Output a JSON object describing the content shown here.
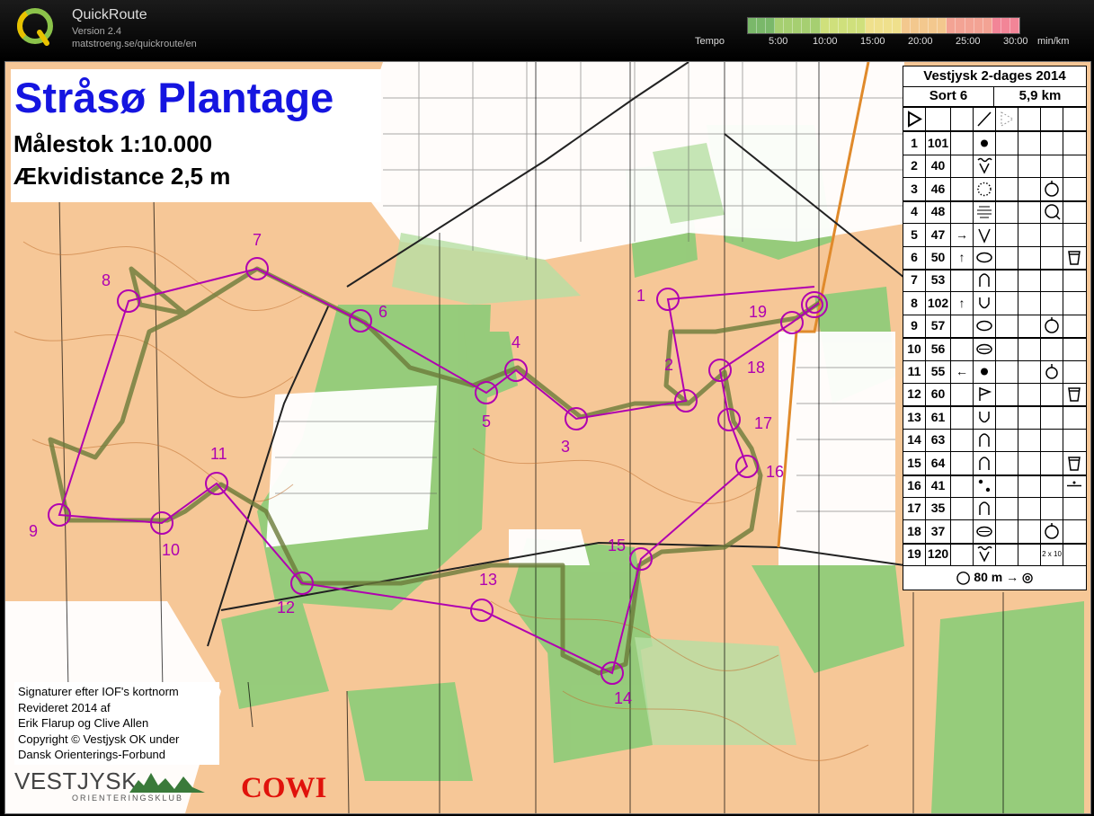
{
  "app": {
    "name": "QuickRoute",
    "version": "Version 2.4",
    "url": "matstroeng.se/quickroute/en",
    "logo_letter": "Q"
  },
  "tempo": {
    "label": "Tempo",
    "ticks": [
      "5:00",
      "10:00",
      "15:00",
      "20:00",
      "25:00",
      "30:00"
    ],
    "unit": "min/km",
    "colors": [
      "#7ab86a",
      "#a6cf71",
      "#cfe07c",
      "#efe08c",
      "#f3c88e",
      "#f3a394",
      "#f28597"
    ]
  },
  "map": {
    "title": "Stråsø Plantage",
    "scale": "Målestok 1:10.000",
    "contour": "Ækvidistance 2,5 m",
    "credits": [
      "Signaturer efter IOF's kortnorm",
      "Revideret 2014 af",
      "Erik Flarup og Clive Allen",
      "Copyright © Vestjysk OK under",
      "Dansk Orienterings-Forbund"
    ],
    "club_name": "VESTJYSK",
    "club_sub": "ORIENTERINGSKLUB",
    "sponsor": "COWI",
    "colors": {
      "course": "#b000b0",
      "route": "#6b7a3a",
      "forest": "#7cbf6a",
      "open": "#f6c797"
    }
  },
  "description": {
    "event": "Vestjysk 2-dages 2014",
    "course": "Sort 6",
    "length": "5,9 km",
    "controls": [
      {
        "n": "1",
        "code": "101",
        "dir": "",
        "sym": "dot",
        "extra": ""
      },
      {
        "n": "2",
        "code": "40",
        "dir": "",
        "sym": "gully",
        "extra": ""
      },
      {
        "n": "3",
        "code": "46",
        "dir": "",
        "sym": "dotted-circle",
        "extra": "ring-e"
      },
      {
        "n": "4",
        "code": "48",
        "dir": "",
        "sym": "lines",
        "extra": "ring-se"
      },
      {
        "n": "5",
        "code": "47",
        "dir": "→",
        "sym": "v",
        "extra": ""
      },
      {
        "n": "6",
        "code": "50",
        "dir": "↑",
        "sym": "oval",
        "extra": "",
        "last": "cup"
      },
      {
        "n": "7",
        "code": "53",
        "dir": "",
        "sym": "knoll",
        "extra": ""
      },
      {
        "n": "8",
        "code": "102",
        "dir": "↑",
        "sym": "u",
        "extra": ""
      },
      {
        "n": "9",
        "code": "57",
        "dir": "",
        "sym": "oval",
        "extra": "ring-e"
      },
      {
        "n": "10",
        "code": "56",
        "dir": "",
        "sym": "oval-line",
        "extra": ""
      },
      {
        "n": "11",
        "code": "55",
        "dir": "←",
        "sym": "dot",
        "extra": "ring-s"
      },
      {
        "n": "12",
        "code": "60",
        "dir": "",
        "sym": "flag",
        "extra": "",
        "last": "cup"
      },
      {
        "n": "13",
        "code": "61",
        "dir": "",
        "sym": "u",
        "extra": ""
      },
      {
        "n": "14",
        "code": "63",
        "dir": "",
        "sym": "knoll",
        "extra": ""
      },
      {
        "n": "15",
        "code": "64",
        "dir": "",
        "sym": "knoll",
        "extra": "",
        "last": "cup"
      },
      {
        "n": "16",
        "code": "41",
        "dir": "",
        "sym": "dots",
        "extra": "",
        "last": "between"
      },
      {
        "n": "17",
        "code": "35",
        "dir": "",
        "sym": "knoll",
        "extra": ""
      },
      {
        "n": "18",
        "code": "37",
        "dir": "",
        "sym": "oval-line",
        "extra": "ring-e"
      },
      {
        "n": "19",
        "code": "120",
        "dir": "",
        "sym": "gully",
        "extra": "",
        "note": "2 x 10"
      }
    ],
    "finish": "80 m"
  },
  "course_controls": [
    {
      "label": "1"
    },
    {
      "label": "2"
    },
    {
      "label": "3"
    },
    {
      "label": "4"
    },
    {
      "label": "5"
    },
    {
      "label": "6"
    },
    {
      "label": "7"
    },
    {
      "label": "8"
    },
    {
      "label": "9"
    },
    {
      "label": "10"
    },
    {
      "label": "11"
    },
    {
      "label": "12"
    },
    {
      "label": "13"
    },
    {
      "label": "14"
    },
    {
      "label": "15"
    },
    {
      "label": "16"
    },
    {
      "label": "17"
    },
    {
      "label": "18"
    },
    {
      "label": "19"
    }
  ]
}
